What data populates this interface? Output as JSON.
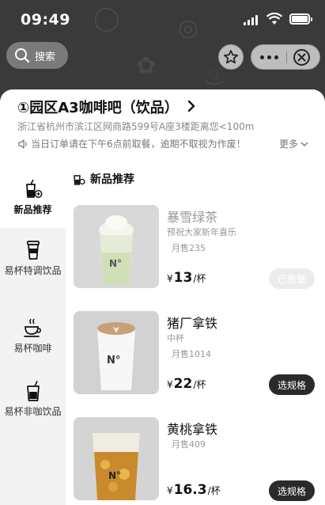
{
  "status_bar": {
    "time": "09:49"
  },
  "nav": {
    "search_label": "搜索"
  },
  "shop": {
    "name": "①园区A3咖啡吧（饮品）",
    "address": "浙江省杭州市滨江区网商路599号A座3楼距离您<100m",
    "notice": "当日订单请在下午6点前取餐，逾期不取视为作废！",
    "more_label": "更多"
  },
  "categories": [
    {
      "label": "新品推荐",
      "icon": "new-drink-icon",
      "active": true
    },
    {
      "label": "易杯特调饮品",
      "icon": "cup-icon",
      "active": false
    },
    {
      "label": "易杯咖啡",
      "icon": "coffee-cup-icon",
      "active": false
    },
    {
      "label": "易杯非咖饮品",
      "icon": "drink-glass-icon",
      "active": false
    }
  ],
  "section": {
    "title": "新品推荐"
  },
  "products": [
    {
      "name": "暴雪绿茶",
      "desc": "预祝大家新年喜乐",
      "sales": "月售235",
      "currency": "¥",
      "price": "13",
      "unit": "/杯",
      "button": "已售罄",
      "sold_out": true
    },
    {
      "name": "猪厂拿铁",
      "desc": "中杯",
      "sales": "月售1014",
      "currency": "¥",
      "price": "22",
      "unit": "/杯",
      "button": "选规格",
      "sold_out": false
    },
    {
      "name": "黄桃拿铁",
      "desc": "",
      "sales": "月售409",
      "currency": "¥",
      "price": "16.3",
      "unit": "/杯",
      "button": "选规格",
      "sold_out": false
    }
  ],
  "colors": {
    "header_bg": "#3a3a3a",
    "button_dark": "#2a2a2a",
    "sold_out_bg": "#ececec"
  }
}
